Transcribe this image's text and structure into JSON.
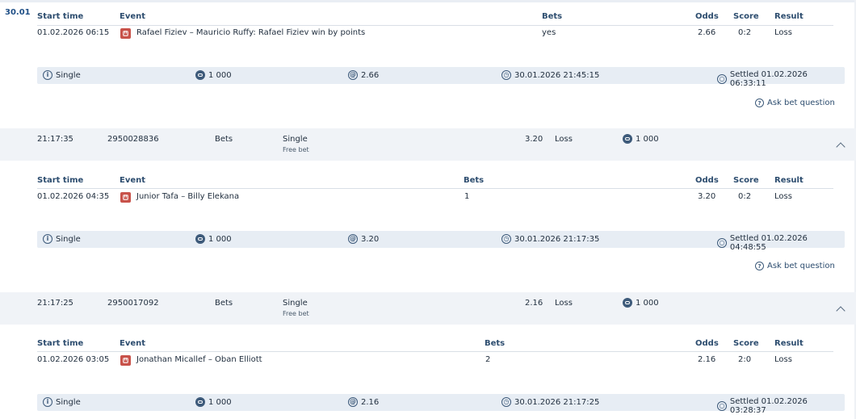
{
  "date_group": "30.01",
  "columns": {
    "start_time": "Start time",
    "event": "Event",
    "bets": "Bets",
    "odds": "Odds",
    "score": "Score",
    "result": "Result"
  },
  "ask_label": "Ask bet question",
  "bets": [
    {
      "detail": {
        "start_time": "01.02.2026 06:15",
        "event": "Rafael Fiziev – Mauricio Ruffy: Rafael Fiziev win by points",
        "bets": "yes",
        "odds": "2.66",
        "score": "0:2",
        "result": "Loss"
      },
      "info": {
        "type": "Single",
        "stake": "1 000",
        "odds": "2.66",
        "placed": "30.01.2026 21:45:15",
        "settled": "Settled 01.02.2026 06:33:11"
      }
    },
    {
      "summary": {
        "time": "21:17:35",
        "id": "2950028836",
        "label": "Bets",
        "type": "Single",
        "sub": "Free bet",
        "odds": "3.20",
        "result": "Loss",
        "stake": "1 000"
      },
      "detail": {
        "start_time": "01.02.2026 04:35",
        "event": "Junior Tafa – Billy Elekana",
        "bets": "1",
        "odds": "3.20",
        "score": "0:2",
        "result": "Loss"
      },
      "info": {
        "type": "Single",
        "stake": "1 000",
        "odds": "3.20",
        "placed": "30.01.2026 21:17:35",
        "settled": "Settled 01.02.2026 04:48:55"
      }
    },
    {
      "summary": {
        "time": "21:17:25",
        "id": "2950017092",
        "label": "Bets",
        "type": "Single",
        "sub": "Free bet",
        "odds": "2.16",
        "result": "Loss",
        "stake": "1 000"
      },
      "detail": {
        "start_time": "01.02.2026 03:05",
        "event": "Jonathan Micallef – Oban Elliott",
        "bets": "2",
        "odds": "2.16",
        "score": "2:0",
        "result": "Loss"
      },
      "info": {
        "type": "Single",
        "stake": "1 000",
        "odds": "2.16",
        "placed": "30.01.2026 21:17:25",
        "settled": "Settled 01.02.2026 03:28:37"
      }
    }
  ]
}
